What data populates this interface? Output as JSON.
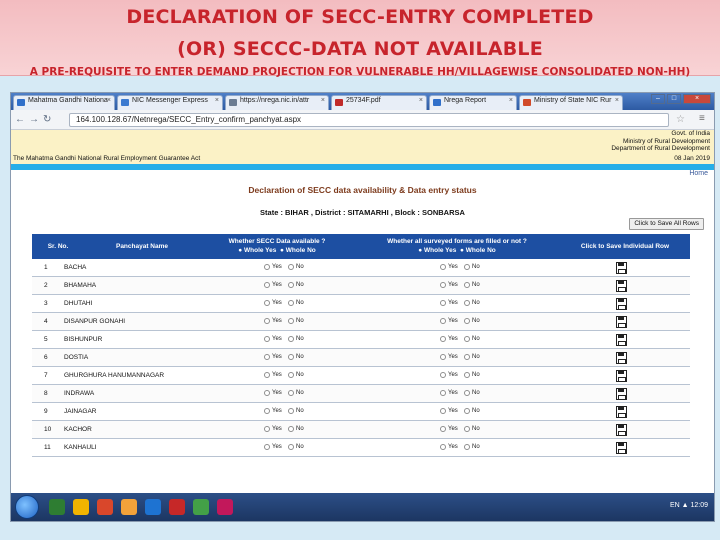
{
  "slide": {
    "title_line1": "DECLARATION OF SECC-ENTRY COMPLETED",
    "title_line2": "(OR) SECCC-DATA NOT AVAILABLE",
    "subtitle": "A PRE-REQUISITE TO ENTER DEMAND PROJECTION FOR VULNERABLE HH/VILLAGEWISE  CONSOLIDATED NON-HH)"
  },
  "browser": {
    "tabs": [
      {
        "label": "Mahatma Gandhi Nationa",
        "color": "#2f6fca"
      },
      {
        "label": "NIC Messenger Express",
        "color": "#3b7ad0"
      },
      {
        "label": "https://nrega.nic.in/attr",
        "color": "#6b7c93"
      },
      {
        "label": "25734F.pdf",
        "color": "#c02a2a"
      },
      {
        "label": "Nrega Report",
        "color": "#2f6fca"
      },
      {
        "label": "Ministry of State NIC Rur",
        "color": "#d04a2a"
      }
    ],
    "url_host": "164.100.128.67",
    "url_path": "/Netnrega/SECC_Entry_confirm_panchyat.aspx"
  },
  "gov": {
    "lines": [
      "Govt. of India",
      "Ministry of Rural Development",
      "Department of Rural Development"
    ],
    "act": "The Mahatma Gandhi National Rural Employment Guarantee Act",
    "date": "08 Jan 2019",
    "home": "Home"
  },
  "content": {
    "title": "Declaration of SECC data availability & Data entry status",
    "state_line": "State : BIHAR , District : SITAMARHI , Block : SONBARSA",
    "save_all": "Click to Save All Rows"
  },
  "table": {
    "headers": {
      "sr": "Sr. No.",
      "panchayat": "Panchayat Name",
      "secc_q": "Whether SECC Data available ?",
      "secc_opts": [
        "Whole Yes",
        "Whole No"
      ],
      "forms_q": "Whether all surveyed forms are filled or not ?",
      "forms_opts": [
        "Whole Yes",
        "Whole No"
      ],
      "save": "Click to Save Individual Row"
    },
    "radio_yes": "Yes",
    "radio_no": "No",
    "rows": [
      {
        "sr": "1",
        "name": "BACHA"
      },
      {
        "sr": "2",
        "name": "BHAMAHA"
      },
      {
        "sr": "3",
        "name": "DHUTAHI"
      },
      {
        "sr": "4",
        "name": "DISANPUR GONAHI"
      },
      {
        "sr": "5",
        "name": "BISHUNPUR"
      },
      {
        "sr": "6",
        "name": "DOSTIA"
      },
      {
        "sr": "7",
        "name": "GHURGHURA HANUMANNAGAR"
      },
      {
        "sr": "8",
        "name": "INDRAWA"
      },
      {
        "sr": "9",
        "name": "JAINAGAR"
      },
      {
        "sr": "10",
        "name": "KACHOR"
      },
      {
        "sr": "11",
        "name": "KANHAULI"
      }
    ]
  },
  "taskbar": {
    "icons": [
      "#2e7d32",
      "#f1b400",
      "#d9472b",
      "#f2a23a",
      "#1e73d2",
      "#c62828",
      "#43a047",
      "#c2185b"
    ],
    "tray": "EN  ▲  12:09"
  }
}
